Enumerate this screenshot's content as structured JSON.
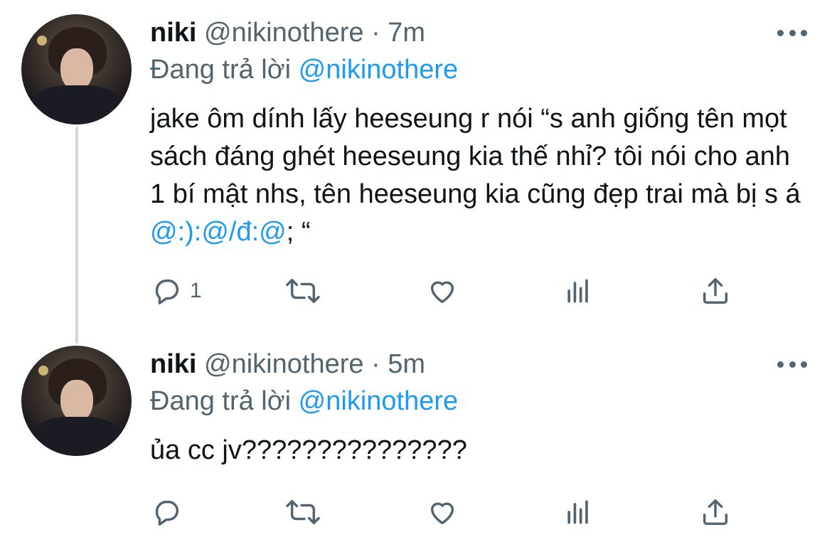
{
  "tweets": [
    {
      "name": "niki",
      "handle": "@nikinothere",
      "separator": "·",
      "time": "7m",
      "reply_prefix": "Đang trả lời",
      "reply_to": "@nikinothere",
      "text_plain": "jake ôm dính lấy heeseung r nói “s anh giống tên mọt sách đáng ghét heeseung kia thế nhỉ? tôi nói cho anh 1 bí mật nhs, tên heeseung kia cũng đẹp trai mà bị s á ",
      "text_links": "@:):@/đ:@",
      "text_tail": "; “",
      "reply_count": "1"
    },
    {
      "name": "niki",
      "handle": "@nikinothere",
      "separator": "·",
      "time": "5m",
      "reply_prefix": "Đang trả lời",
      "reply_to": "@nikinothere",
      "text_plain": "ủa cc jv???????????????",
      "text_links": "",
      "text_tail": "",
      "reply_count": ""
    }
  ],
  "icons": [
    "reply-icon",
    "retweet-icon",
    "like-icon",
    "analytics-icon",
    "share-icon",
    "more-icon"
  ],
  "colors": {
    "link": "#1d9bf0",
    "muted": "#536471",
    "text": "#0f1419",
    "thread_line": "#cfd9de"
  }
}
